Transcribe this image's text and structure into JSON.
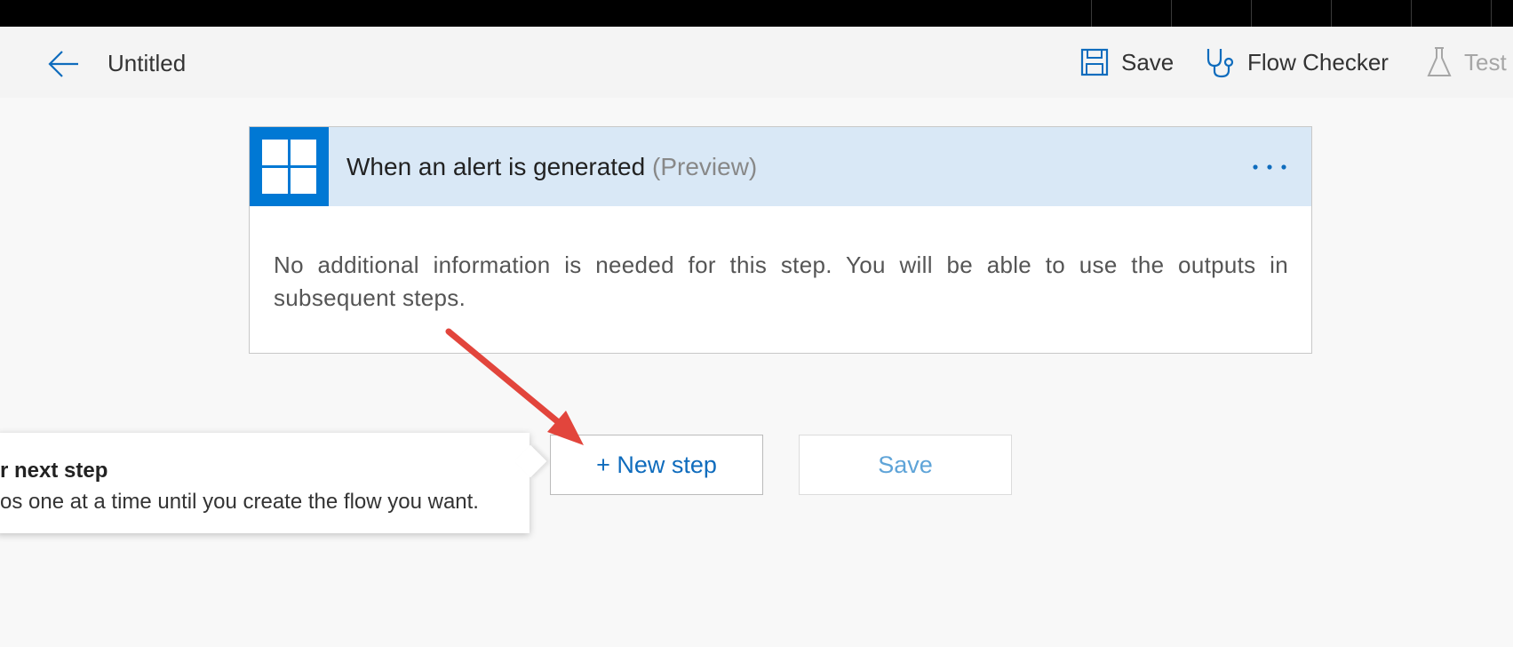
{
  "header": {
    "title": "Untitled",
    "save_label": "Save",
    "flow_checker_label": "Flow Checker",
    "test_label": "Test"
  },
  "trigger_card": {
    "title": "When an alert is generated",
    "preview_label": "(Preview)",
    "body": "No additional information is needed for this step. You will be able to use the outputs in subsequent steps."
  },
  "actions": {
    "new_step_label": "+ New step",
    "save_label": "Save"
  },
  "callout": {
    "title": "r next step",
    "text": "os one at a time until you create the flow you want."
  },
  "icons": {
    "back": "back-arrow-icon",
    "save": "floppy-disk-icon",
    "flow_checker": "stethoscope-icon",
    "test": "flask-icon",
    "connector": "windows-logo-icon",
    "more": "ellipsis-icon"
  },
  "colors": {
    "accent": "#0078d4",
    "header_bg": "#d9e8f6",
    "annotation_arrow": "#e2453c"
  }
}
